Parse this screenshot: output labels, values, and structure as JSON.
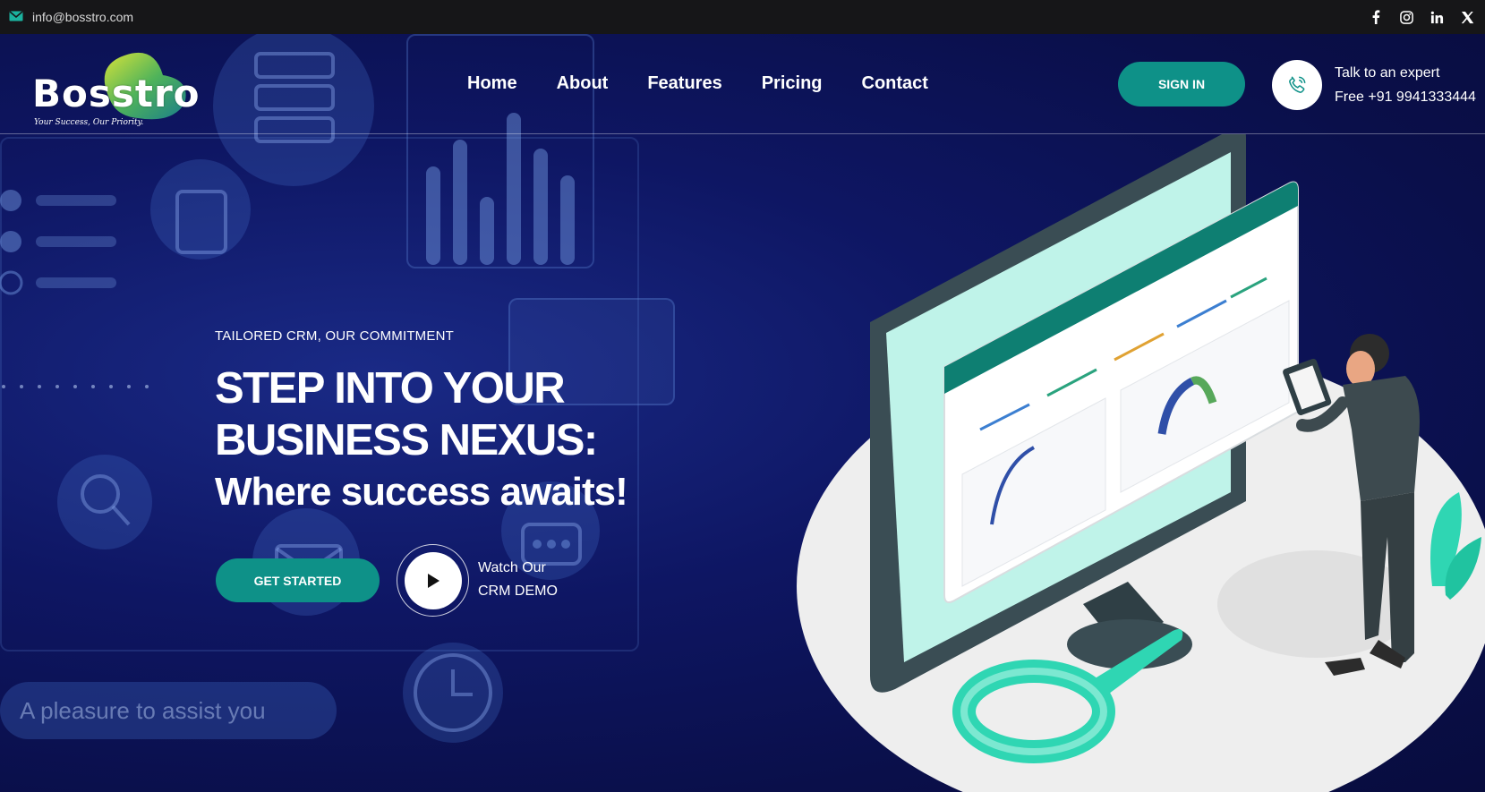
{
  "topbar": {
    "email": "info@bosstro.com",
    "socials": [
      "facebook-icon",
      "instagram-icon",
      "linkedin-icon",
      "x-icon"
    ]
  },
  "brand": {
    "name": "Bosstro",
    "tagline": "Your Success, Our Priority."
  },
  "nav": {
    "items": [
      "Home",
      "About",
      "Features",
      "Pricing",
      "Contact"
    ]
  },
  "header": {
    "signin_label": "SIGN IN",
    "expert_line1": "Talk to an expert",
    "expert_line2": "Free +91 9941333444"
  },
  "hero": {
    "eyebrow": "TAILORED CRM, OUR COMMITMENT",
    "headline_line1": "STEP INTO YOUR",
    "headline_line2": "BUSINESS NEXUS:",
    "subheadline": "Where success awaits!",
    "cta_label": "GET STARTED",
    "demo_line1": "Watch Our",
    "demo_line2": "CRM DEMO",
    "background_bubble": "A pleasure to assist you"
  },
  "colors": {
    "accent": "#0e9188",
    "background": "#0a1048",
    "topbar": "#161618"
  }
}
